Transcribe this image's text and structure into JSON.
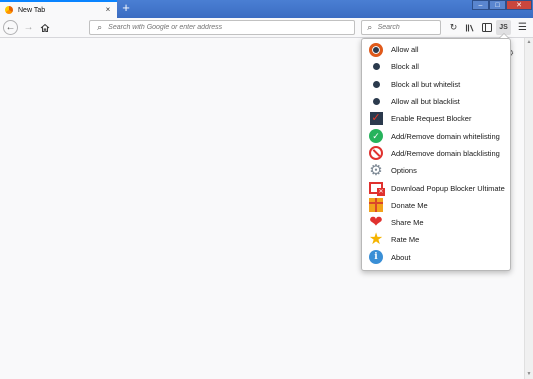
{
  "window": {
    "tab_title": "New Tab",
    "tab_close": "×",
    "new_tab": "+",
    "minimize": "–",
    "maximize": "□",
    "close": "✕"
  },
  "toolbar": {
    "url_placeholder": "Search with Google or enter address",
    "search_placeholder": "Search",
    "extension_label": "JS"
  },
  "menu": {
    "items": [
      {
        "label": "Allow all",
        "icon": "radio-selected-icon"
      },
      {
        "label": "Block all",
        "icon": "radio-dot-icon"
      },
      {
        "label": "Block all but whitelist",
        "icon": "radio-dot-icon"
      },
      {
        "label": "Allow all but blacklist",
        "icon": "radio-dot-icon"
      },
      {
        "label": "Enable Request Blocker",
        "icon": "checkbox-checked-icon"
      },
      {
        "label": "Add/Remove domain whitelisting",
        "icon": "check-circle-icon"
      },
      {
        "label": "Add/Remove domain blacklisting",
        "icon": "block-circle-icon"
      },
      {
        "label": "Options",
        "icon": "gear-icon"
      },
      {
        "label": "Download Popup Blocker Ultimate",
        "icon": "popup-blocker-icon"
      },
      {
        "label": "Donate Me",
        "icon": "gift-icon"
      },
      {
        "label": "Share Me",
        "icon": "heart-icon"
      },
      {
        "label": "Rate Me",
        "icon": "star-icon"
      },
      {
        "label": "About",
        "icon": "info-icon"
      }
    ]
  },
  "colors": {
    "titlebar": "#3b6cc2",
    "accent_orange": "#e05a1b",
    "dark_navy": "#2b3a4d",
    "green": "#27b35c",
    "red": "#e0312e",
    "blue_info": "#3a8fd6",
    "gold": "#f5b400"
  }
}
